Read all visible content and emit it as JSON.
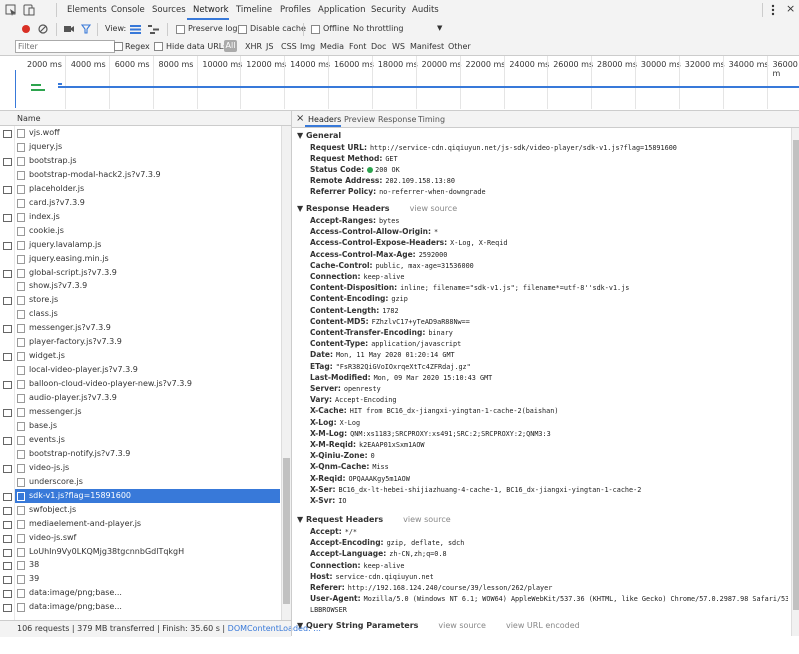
{
  "tabs": [
    "Elements",
    "Console",
    "Sources",
    "Network",
    "Timeline",
    "Profiles",
    "Application",
    "Security",
    "Audits"
  ],
  "active_tab": "Network",
  "toolbar": {
    "view_label": "View:",
    "preserve_log": "Preserve log",
    "disable_cache": "Disable cache",
    "offline": "Offline",
    "throttling": "No throttling"
  },
  "filter": {
    "placeholder": "Filter",
    "regex": "Regex",
    "hide_data_urls": "Hide data URLs",
    "all": "All",
    "types": [
      "XHR",
      "JS",
      "CSS",
      "Img",
      "Media",
      "Font",
      "Doc",
      "WS",
      "Manifest",
      "Other"
    ]
  },
  "timeline_ticks": [
    "2000 ms",
    "4000 ms",
    "6000 ms",
    "8000 ms",
    "10000 ms",
    "12000 ms",
    "14000 ms",
    "16000 ms",
    "18000 ms",
    "20000 ms",
    "22000 ms",
    "24000 ms",
    "26000 ms",
    "28000 ms",
    "30000 ms",
    "32000 ms",
    "34000 ms",
    "36000 m"
  ],
  "list_header": "Name",
  "files": [
    "vjs.woff",
    "jquery.js",
    "bootstrap.js",
    "bootstrap-modal-hack2.js?v7.3.9",
    "placeholder.js",
    "card.js?v7.3.9",
    "index.js",
    "cookie.js",
    "jquery.lavalamp.js",
    "jquery.easing.min.js",
    "global-script.js?v7.3.9",
    "show.js?v7.3.9",
    "store.js",
    "class.js",
    "messenger.js?v7.3.9",
    "player-factory.js?v7.3.9",
    "widget.js",
    "local-video-player.js?v7.3.9",
    "balloon-cloud-video-player-new.js?v7.3.9",
    "audio-player.js?v7.3.9",
    "messenger.js",
    "base.js",
    "events.js",
    "bootstrap-notify.js?v7.3.9",
    "video-js.js",
    "underscore.js",
    "sdk-v1.js?flag=15891600",
    "swfobject.js",
    "mediaelement-and-player.js",
    "video-js.swf",
    "LoUhIn9Vy0LKQMjg38tgcnnbGdlTqkgH",
    "38",
    "39",
    "data:image/png;base...",
    "data:image/png;base..."
  ],
  "selected_file": "sdk-v1.js?flag=15891600",
  "status_bar": "106 requests | 379 MB transferred | Finish: 35.60 s | DOMContentLoaded: ...",
  "detail_tabs": [
    "Headers",
    "Preview",
    "Response",
    "Timing"
  ],
  "detail_close": "×",
  "general": {
    "title": "General",
    "request_url": "http://service-cdn.qiqiuyun.net/js-sdk/video-player/sdk-v1.js?flag=15891600",
    "request_method": "GET",
    "status_code": "200 OK",
    "remote_address": "202.109.158.13:80",
    "referrer_policy": "no-referrer-when-downgrade"
  },
  "response_headers_title": "Response Headers",
  "view_source": "view source",
  "response_headers": [
    [
      "Accept-Ranges:",
      "bytes"
    ],
    [
      "Access-Control-Allow-Origin:",
      "*"
    ],
    [
      "Access-Control-Expose-Headers:",
      "X-Log, X-Reqid"
    ],
    [
      "Access-Control-Max-Age:",
      "2592000"
    ],
    [
      "Cache-Control:",
      "public, max-age=31536000"
    ],
    [
      "Connection:",
      "keep-alive"
    ],
    [
      "Content-Disposition:",
      "inline; filename=\"sdk-v1.js\"; filename*=utf-8''sdk-v1.js"
    ],
    [
      "Content-Encoding:",
      "gzip"
    ],
    [
      "Content-Length:",
      "1782"
    ],
    [
      "Content-MD5:",
      "FZhzlvC17+yTeAD9aR88Nw=="
    ],
    [
      "Content-Transfer-Encoding:",
      "binary"
    ],
    [
      "Content-Type:",
      "application/javascript"
    ],
    [
      "Date:",
      "Mon, 11 May 2020 01:20:14 GMT"
    ],
    [
      "ETag:",
      "\"FsR382QiGVoIOxrqeXtTc4ZFRdaj.gz\""
    ],
    [
      "Last-Modified:",
      "Mon, 09 Mar 2020 15:10:43 GMT"
    ],
    [
      "Server:",
      "openresty"
    ],
    [
      "Vary:",
      "Accept-Encoding"
    ],
    [
      "X-Cache:",
      "HIT from BC16_dx-jiangxi-yingtan-1-cache-2(baishan)"
    ],
    [
      "X-Log:",
      "X-Log"
    ],
    [
      "X-M-Log:",
      "QNM:xs1183;SRCPROXY:xs491;SRC:2;SRCPROXY:2;QNM3:3"
    ],
    [
      "X-M-Reqid:",
      "k2EAAP01xSxm1AOW"
    ],
    [
      "X-Qiniu-Zone:",
      "0"
    ],
    [
      "X-Qnm-Cache:",
      "Miss"
    ],
    [
      "X-Reqid:",
      "OPQAAAKgy5m1AOW"
    ],
    [
      "X-Ser:",
      "BC16_dx-lt-hebei-shijiazhuang-4-cache-1, BC16_dx-jiangxi-yingtan-1-cache-2"
    ],
    [
      "X-Svr:",
      "IO"
    ]
  ],
  "request_headers_title": "Request Headers",
  "request_headers": [
    [
      "Accept:",
      "*/*"
    ],
    [
      "Accept-Encoding:",
      "gzip, deflate, sdch"
    ],
    [
      "Accept-Language:",
      "zh-CN,zh;q=0.8"
    ],
    [
      "Connection:",
      "keep-alive"
    ],
    [
      "Host:",
      "service-cdn.qiqiuyun.net"
    ],
    [
      "Referer:",
      "http://192.168.124.240/course/39/lesson/262/player"
    ],
    [
      "User-Agent:",
      "Mozilla/5.0 (Windows NT 6.1; WOW64) AppleWebKit/537.36 (KHTML, like Gecko) Chrome/57.0.2987.98 Safari/537.36"
    ]
  ],
  "user_agent_wrap": "LBBROWSER",
  "query_title": "Query String Parameters",
  "view_url_encoded": "view URL encoded",
  "icons": {
    "inspect": "cursor-in-box-icon",
    "device": "mobile-icon",
    "record": "record-icon",
    "clear": "clear-icon",
    "camera": "camera-icon",
    "filter": "filter-icon",
    "more": "kebab-icon",
    "close": "close-icon"
  },
  "colors": {
    "accent": "#3879d9",
    "record": "#d93025",
    "status_ok": "#2da44e"
  }
}
